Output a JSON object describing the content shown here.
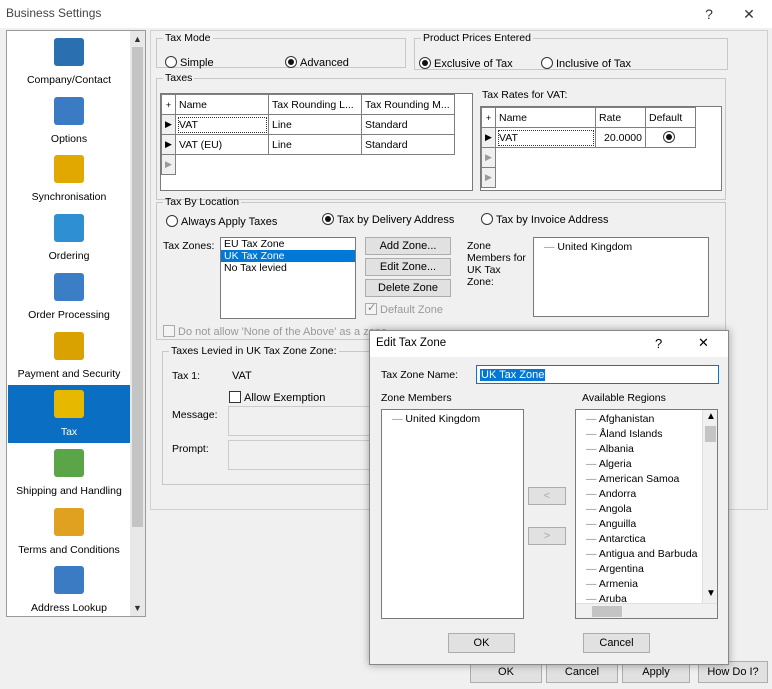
{
  "window": {
    "title": "Business Settings",
    "help_glyph": "?",
    "close_glyph": "✕"
  },
  "nav": {
    "items": [
      {
        "label": "Company/Contact",
        "icon": "building-icon"
      },
      {
        "label": "Options",
        "icon": "gears-icon"
      },
      {
        "label": "Synchronisation",
        "icon": "database-sync-icon"
      },
      {
        "label": "Ordering",
        "icon": "shopping-cart-icon"
      },
      {
        "label": "Order Processing",
        "icon": "spreadsheet-icon"
      },
      {
        "label": "Payment and Security",
        "icon": "credit-card-icon"
      },
      {
        "label": "Tax",
        "icon": "coins-icon"
      },
      {
        "label": "Shipping and Handling",
        "icon": "package-icon"
      },
      {
        "label": "Terms and Conditions",
        "icon": "handshake-icon"
      },
      {
        "label": "Address Lookup",
        "icon": "address-card-icon"
      }
    ],
    "active": "Tax",
    "scroll_up": "▲",
    "scroll_down": "▼"
  },
  "tax_mode": {
    "legend": "Tax Mode",
    "simple": "Simple",
    "advanced": "Advanced",
    "selected": "Advanced"
  },
  "prices": {
    "legend": "Product Prices Entered",
    "exclusive": "Exclusive of Tax",
    "inclusive": "Inclusive of Tax",
    "selected": "Exclusive of Tax"
  },
  "taxes": {
    "legend": "Taxes",
    "columns": [
      "Name",
      "Tax Rounding L...",
      "Tax Rounding M..."
    ],
    "rows": [
      {
        "name": "VAT",
        "level": "Line",
        "method": "Standard"
      },
      {
        "name": "VAT (EU)",
        "level": "Line",
        "method": "Standard"
      }
    ],
    "add_glyph": "+",
    "row_glyph": "▶"
  },
  "rates": {
    "label": "Tax Rates for VAT:",
    "columns": [
      "Name",
      "Rate",
      "Default"
    ],
    "rows": [
      {
        "name": "VAT",
        "rate": "20.0000"
      }
    ]
  },
  "location": {
    "legend": "Tax By Location",
    "always": "Always Apply Taxes",
    "delivery": "Tax by Delivery Address",
    "invoice": "Tax by Invoice Address",
    "selected": "Tax by Delivery Address",
    "zones_label": "Tax Zones:",
    "zones": [
      "EU Tax Zone",
      "UK Tax Zone",
      "No Tax levied"
    ],
    "selected_zone": "UK Tax Zone",
    "add_zone": "Add Zone...",
    "edit_zone": "Edit Zone...",
    "delete_zone": "Delete Zone",
    "default_zone": "Default Zone",
    "members_label_1": "Zone",
    "members_label_2": "Members for",
    "members_label_3": "UK Tax",
    "members_label_4": "Zone:",
    "members": [
      "United Kingdom"
    ],
    "none_of_above": "Do not allow 'None of the Above' as a zone"
  },
  "levied": {
    "legend": "Taxes Levied in UK Tax Zone Zone:",
    "tax1_label": "Tax 1:",
    "tax1_value": "VAT",
    "allow_exemption": "Allow Exemption",
    "message_label": "Message:",
    "prompt_label": "Prompt:"
  },
  "dialog": {
    "title": "Edit Tax Zone",
    "help_glyph": "?",
    "close_glyph": "✕",
    "zone_name_label": "Tax Zone Name:",
    "zone_name_value": "UK Tax Zone",
    "members_label": "Zone Members",
    "members": [
      "United Kingdom"
    ],
    "regions_label": "Available Regions",
    "regions": [
      "Afghanistan",
      "Åland Islands",
      "Albania",
      "Algeria",
      "American Samoa",
      "Andorra",
      "Angola",
      "Anguilla",
      "Antarctica",
      "Antigua and Barbuda",
      "Argentina",
      "Armenia",
      "Aruba"
    ],
    "move_left": "<",
    "move_right": ">",
    "ok": "OK",
    "cancel": "Cancel"
  },
  "footer": {
    "ok": "OK",
    "cancel": "Cancel",
    "apply": "Apply",
    "how": "How Do I?"
  }
}
